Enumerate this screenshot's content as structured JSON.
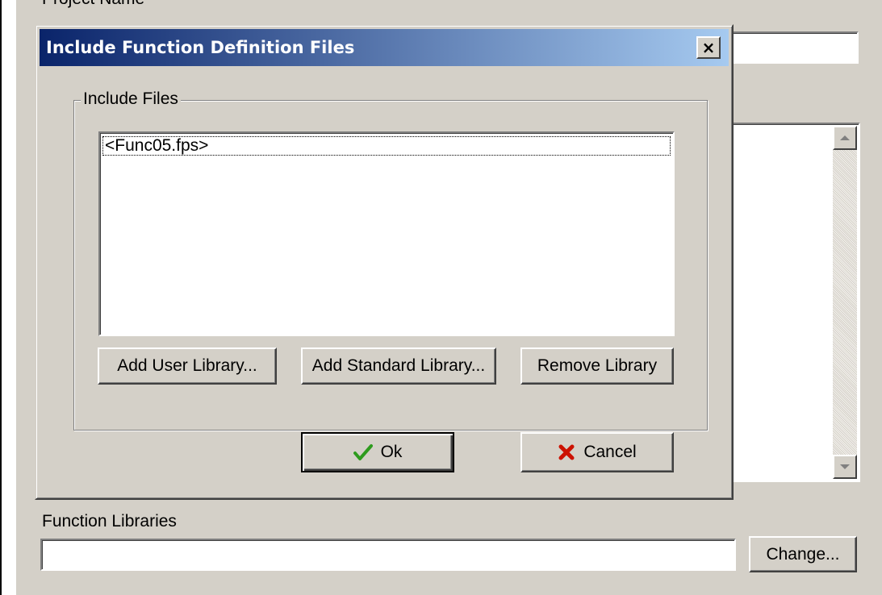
{
  "background": {
    "project_name_label": "Project Name",
    "function_libraries_label": "Function Libraries",
    "function_libraries_value": "",
    "change_button": "Change..."
  },
  "dialog": {
    "title": "Include Function Definition Files",
    "close_glyph": "×",
    "group_label": "Include Files",
    "files": [
      "<Func05.fps>"
    ],
    "buttons": {
      "add_user": "Add User Library...",
      "add_standard": "Add Standard Library...",
      "remove": "Remove Library",
      "ok": "Ok",
      "cancel": "Cancel"
    },
    "icons": {
      "ok": "checkmark-icon",
      "cancel": "x-icon"
    }
  },
  "colors": {
    "titlebar_start": "#0a246a",
    "titlebar_end": "#a6caf0",
    "face": "#d4d0c8",
    "ok_check": "#2e9b1e",
    "cancel_x": "#cc1100"
  }
}
